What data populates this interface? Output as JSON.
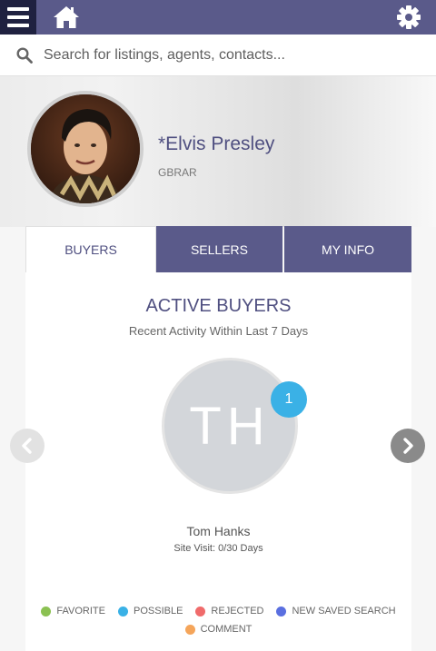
{
  "header": {
    "menu_icon": "hamburger-menu-icon",
    "home_icon": "home-icon",
    "settings_icon": "gear-icon",
    "bar_color": "#5a5a8a",
    "menu_bg_color": "#1f2140"
  },
  "search": {
    "icon": "search-icon",
    "placeholder": "Search for listings, agents, contacts..."
  },
  "profile": {
    "name": "*Elvis Presley",
    "organization": "GBRAR",
    "avatar": "agent-photo"
  },
  "tabs": [
    {
      "label": "BUYERS",
      "active": true
    },
    {
      "label": "SELLERS",
      "active": false
    },
    {
      "label": "MY INFO",
      "active": false
    }
  ],
  "main": {
    "title": "ACTIVE BUYERS",
    "subtitle": "Recent Activity Within Last 7 Days",
    "buyer": {
      "initials": "TH",
      "badge_count": "1",
      "name": "Tom Hanks",
      "site_visit": "Site Visit: 0/30 Days"
    },
    "prev_icon": "chevron-left-icon",
    "next_icon": "chevron-right-icon"
  },
  "legend": [
    {
      "label": "FAVORITE",
      "color": "#8bc152"
    },
    {
      "label": "POSSIBLE",
      "color": "#3ab1e6"
    },
    {
      "label": "REJECTED",
      "color": "#f06b6b"
    },
    {
      "label": "NEW SAVED SEARCH",
      "color": "#5a6fe0"
    },
    {
      "label": "COMMENT",
      "color": "#f5a55a"
    }
  ]
}
